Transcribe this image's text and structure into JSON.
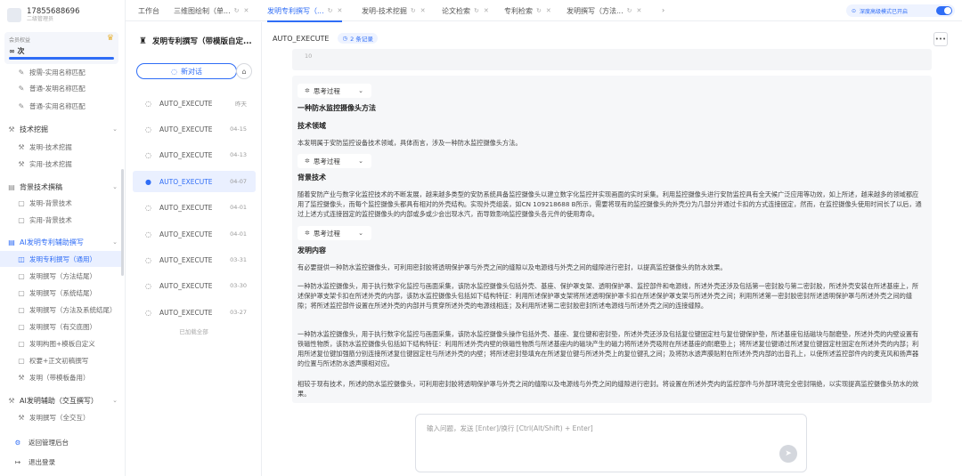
{
  "user": {
    "phone": "17855688696",
    "role": "二级管理员"
  },
  "member": {
    "label": "会员权益",
    "value": "∞ 次"
  },
  "sidebar": {
    "items": [
      {
        "label": "按需-实用名称匹配",
        "type": "sub",
        "icon": "pen"
      },
      {
        "label": "普通-发明名称匹配",
        "type": "sub",
        "icon": "pen"
      },
      {
        "label": "普通-实用名称匹配",
        "type": "sub",
        "icon": "pen"
      },
      {
        "label": "技术挖掘",
        "type": "group",
        "icon": "mining"
      },
      {
        "label": "发明-技术挖掘",
        "type": "sub",
        "icon": "mining"
      },
      {
        "label": "实用-技术挖掘",
        "type": "sub",
        "icon": "mining"
      },
      {
        "label": "背景技术撰稿",
        "type": "group",
        "icon": "doc"
      },
      {
        "label": "发明-背景技术",
        "type": "sub",
        "icon": "doc"
      },
      {
        "label": "实用-背景技术",
        "type": "sub",
        "icon": "doc"
      },
      {
        "label": "AI发明专利辅助撰写",
        "type": "group",
        "icon": "doc",
        "open": true
      },
      {
        "label": "发明专利撰写（通用）",
        "type": "sub",
        "icon": "book",
        "active": true
      },
      {
        "label": "发明撰写（方法结尾）",
        "type": "sub",
        "icon": "doc"
      },
      {
        "label": "发明撰写（系统结尾）",
        "type": "sub",
        "icon": "doc"
      },
      {
        "label": "发明撰写（方法及系统结尾）",
        "type": "sub",
        "icon": "doc"
      },
      {
        "label": "发明撰写（有交底图）",
        "type": "sub",
        "icon": "doc"
      },
      {
        "label": "发明构图+模板自定义",
        "type": "sub",
        "icon": "doc"
      },
      {
        "label": "权要+正文初稿撰写",
        "type": "sub",
        "icon": "doc"
      },
      {
        "label": "发明（带模板备用）",
        "type": "sub",
        "icon": "mining"
      },
      {
        "label": "AI发明辅助（交互撰写）",
        "type": "group",
        "icon": "mining"
      },
      {
        "label": "发明撰写（全交互）",
        "type": "sub",
        "icon": "mining"
      }
    ],
    "bottom": [
      {
        "label": "返回管理后台",
        "icon": "gear"
      },
      {
        "label": "退出登录",
        "icon": "logout"
      }
    ]
  },
  "tabs": [
    {
      "label": "工作台",
      "active": false,
      "closable": false
    },
    {
      "label": "三维图绘制（单...",
      "active": false,
      "closable": true
    },
    {
      "label": "发明专利撰写（...",
      "active": true,
      "closable": true
    },
    {
      "label": "发明-技术挖掘",
      "active": false,
      "closable": true
    },
    {
      "label": "论文检索",
      "active": false,
      "closable": true
    },
    {
      "label": "专利检索",
      "active": false,
      "closable": true
    },
    {
      "label": "发明撰写（方法...",
      "active": false,
      "closable": true
    }
  ],
  "deep_mode": {
    "label": "深度高级模式已开启",
    "on": true
  },
  "conversation_panel": {
    "title": "发明专利撰写（带模版自定...",
    "new_chat": "新对话",
    "items": [
      {
        "name": "AUTO_EXECUTE",
        "date": "昨天"
      },
      {
        "name": "AUTO_EXECUTE",
        "date": "04-15"
      },
      {
        "name": "AUTO_EXECUTE",
        "date": "04-13"
      },
      {
        "name": "AUTO_EXECUTE",
        "date": "04-07",
        "active": true
      },
      {
        "name": "AUTO_EXECUTE",
        "date": "04-01"
      },
      {
        "name": "AUTO_EXECUTE",
        "date": "04-01"
      },
      {
        "name": "AUTO_EXECUTE",
        "date": "03-31"
      },
      {
        "name": "AUTO_EXECUTE",
        "date": "03-30"
      },
      {
        "name": "AUTO_EXECUTE",
        "date": "03-27"
      }
    ],
    "load_all": "已加载全部"
  },
  "main": {
    "title": "AUTO_EXECUTE",
    "records": "2 条记录",
    "top_value": "10",
    "thinking_label": "思考过程",
    "content": {
      "title": "一种防水监控摄像头方法",
      "tech_field_heading": "技术领域",
      "tech_field_text": "本发明属于安防监控设备技术领域，具体而言，涉及一种防水监控摄像头方法。",
      "background_heading": "背景技术",
      "background_text": "随着安防产业与数字化监控技术的不断发展，越来越多类型的安防系统具备监控摄像头以建立数字化监控并实现画面的实时采集。利用监控摄像头进行安防监控具有全天候广泛应用等功效，如上所述，越来越多的领域都应用了监控摄像头，而每个监控摄像头都具有相对的外壳结构。实现外壳组装，如CN 109218688 B所示，需要将现有的监控摄像头的外壳分为几部分并通过卡扣的方式连接固定，然而，在监控摄像头使用时间长了以后，通过上述方式连接固定的监控摄像头的内部或多或少会出现水汽，而导致影响监控摄像头各元件的使用寿命。",
      "invention_heading": "发明内容",
      "inv_p1": "有必要提供一种防水监控摄像头，可利用密封胶将透明保护罩与外壳之间的缝隙以及电源线与外壳之间的缝隙进行密封，以提高监控摄像头的防水效果。",
      "inv_p2": "一种防水监控摄像头，用于执行数字化监控与画面采集，该防水监控摄像头包括外壳、基座、保护罩支架、透明保护罩、监控部件和电源线，所述外壳还涉及包括第一密封胶与第二密封胶，所述外壳安装在所述基座上，所述保护罩支架卡扣在所述外壳的内部，该防水监控摄像头包括如下结构特征：利用所述保护罩支架将所述透明保护罩卡扣在所述保护罩支架与所述外壳之间；利用所述第一密封胶密封所述透明保护罩与所述外壳之间的缝隙；将所述监控部件设置在所述外壳的内部并与贯穿所述外壳的电源线相连；及利用所述第二密封胶密封所述电源线与所述外壳之间的连接缝隙。",
      "inv_p3": "一种防水监控摄像头，用于执行数字化监控与画面采集，该防水监控摄像头操作包括外壳、基座、复位键和密封垫，所述外壳还涉及包括复位键固定柱与复位键保护垫，所述基座包括磁块与耐磨垫，所述外壳的内壁设置有铁磁性物质，该防水监控摄像头包括如下结构特征：利用所述外壳内壁的铁磁性物质与所述基座内的磁块产生的磁力将所述外壳吸附在所述基座的耐磨垫上；将所述复位键通过所述复位键固定柱固定在所述外壳的内部；利用所述复位键加强筋分别连接所述复位键固定柱与所述外壳的内壁；将所述密封垫填充在所述复位键与所述外壳上的复位键孔之间；及将防水透声膜贴附在所述外壳内部的出音孔上，以使所述监控部件内的麦克风和扬声器的位置与所述防水透声膜相对应。",
      "inv_p4": "相较于现有技术，所述的防水监控摄像头，可利用密封胶将透明保护罩与外壳之间的缝隙以及电源线与外壳之间的缝隙进行密封。将设置在所述外壳内的监控部件与外部环境完全密封隔绝，以实现提高监控摄像头防水的效果。"
    },
    "input_placeholder": "输入问题，发送 [Enter]/换行 [Ctrl(Alt/Shift) + Enter]"
  },
  "colors": {
    "accent": "#2f6df6",
    "active_bg": "#eaf0ff"
  }
}
